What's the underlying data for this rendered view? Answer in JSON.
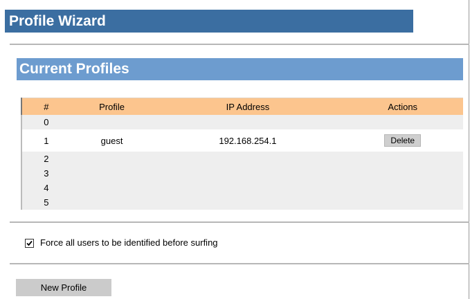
{
  "wizard": {
    "title": "Profile Wizard"
  },
  "section": {
    "title": "Current Profiles"
  },
  "table": {
    "headers": {
      "num": "#",
      "profile": "Profile",
      "ip": "IP Address",
      "actions": "Actions"
    },
    "rows": [
      {
        "num": "0",
        "profile": "",
        "ip": "",
        "action": ""
      },
      {
        "num": "1",
        "profile": "guest",
        "ip": "192.168.254.1",
        "action": "Delete"
      },
      {
        "num": "2",
        "profile": "",
        "ip": "",
        "action": ""
      },
      {
        "num": "3",
        "profile": "",
        "ip": "",
        "action": ""
      },
      {
        "num": "4",
        "profile": "",
        "ip": "",
        "action": ""
      },
      {
        "num": "5",
        "profile": "",
        "ip": "",
        "action": ""
      }
    ]
  },
  "force_identify": {
    "label": "Force all users to be identified before surfing",
    "checked": true
  },
  "buttons": {
    "new_profile": "New Profile"
  },
  "colors": {
    "wizard_header": "#3b6ea1",
    "section_header": "#6d9ccf",
    "table_header": "#fcc58e",
    "row_shade": "#eeeeee"
  }
}
